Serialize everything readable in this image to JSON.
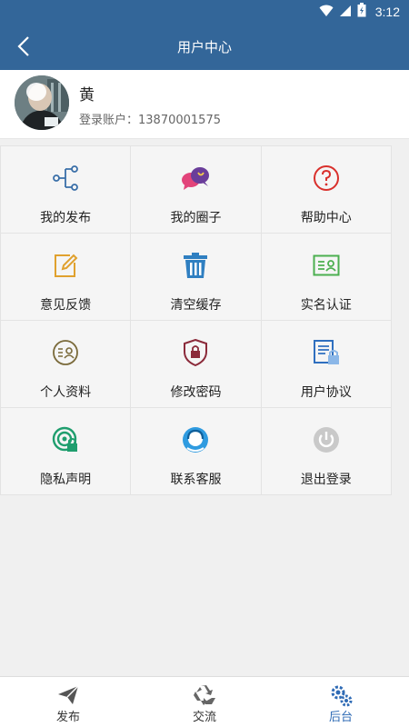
{
  "status_bar": {
    "time": "3:12"
  },
  "header": {
    "title": "用户中心"
  },
  "profile": {
    "name": "黄",
    "account": "登录账户：13870001575"
  },
  "menu": [
    {
      "label": "我的发布",
      "icon": "share-tree-icon"
    },
    {
      "label": "我的圈子",
      "icon": "chat-bubbles-icon"
    },
    {
      "label": "帮助中心",
      "icon": "help-circle-icon"
    },
    {
      "label": "意见反馈",
      "icon": "edit-note-icon"
    },
    {
      "label": "清空缓存",
      "icon": "trash-icon"
    },
    {
      "label": "实名认证",
      "icon": "id-card-icon"
    },
    {
      "label": "个人资料",
      "icon": "profile-icon"
    },
    {
      "label": "修改密码",
      "icon": "shield-lock-icon"
    },
    {
      "label": "用户协议",
      "icon": "document-lock-icon"
    },
    {
      "label": "隐私声明",
      "icon": "privacy-lock-icon"
    },
    {
      "label": "联系客服",
      "icon": "customer-service-icon"
    },
    {
      "label": "退出登录",
      "icon": "power-icon"
    }
  ],
  "bottom_nav": [
    {
      "label": "发布",
      "icon": "paper-plane-icon",
      "active": false
    },
    {
      "label": "交流",
      "icon": "recycle-icon",
      "active": false
    },
    {
      "label": "后台",
      "icon": "gears-icon",
      "active": true
    }
  ],
  "colors": {
    "primary": "#336699",
    "active_tab": "#2f6bb5"
  }
}
